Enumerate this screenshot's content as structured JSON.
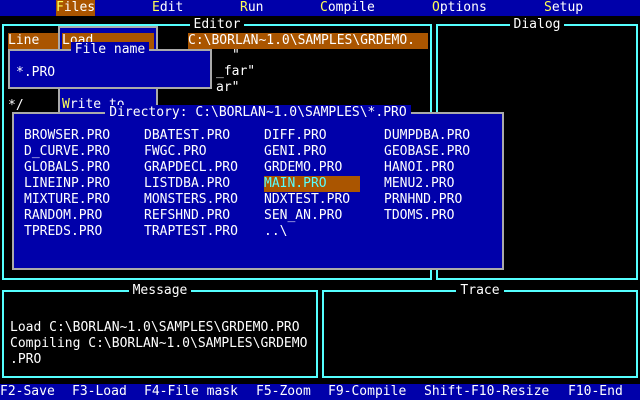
{
  "menu": {
    "items": [
      {
        "hot": "F",
        "rest": "iles",
        "active": true
      },
      {
        "hot": "E",
        "rest": "dit",
        "active": false
      },
      {
        "hot": "R",
        "rest": "un",
        "active": false
      },
      {
        "hot": "C",
        "rest": "ompile",
        "active": false
      },
      {
        "hot": "O",
        "rest": "ptions",
        "active": false
      },
      {
        "hot": "S",
        "rest": "etup",
        "active": false
      }
    ]
  },
  "editor": {
    "title": "Editor",
    "line_label": "Line",
    "path": "C:\\BORLAN~1.0\\SAMPLES\\GRDEMO.",
    "fragments": [
      "\"",
      "_far\"",
      "ar\""
    ],
    "comment_end": "*/"
  },
  "dialog_window": {
    "title": "Dialog"
  },
  "load_menu": {
    "load_label": "Load",
    "write_label": "Write to"
  },
  "file_name": {
    "title": "File name",
    "value": "*.PRO"
  },
  "directory": {
    "title": "Directory: C:\\BORLAN~1.0\\SAMPLES\\*.PRO",
    "columns": [
      [
        "BROWSER.PRO",
        "D_CURVE.PRO",
        "GLOBALS.PRO",
        "LINEINP.PRO",
        "MIXTURE.PRO",
        "RANDOM.PRO",
        "TPREDS.PRO"
      ],
      [
        "DBATEST.PRO",
        "FWGC.PRO",
        "GRAPDECL.PRO",
        "LISTDBA.PRO",
        "MONSTERS.PRO",
        "REFSHND.PRO",
        "TRAPTEST.PRO"
      ],
      [
        "DIFF.PRO",
        "GENI.PRO",
        "GRDEMO.PRO",
        "MAIN.PRO",
        "NDXTEST.PRO",
        "SEN_AN.PRO",
        "..\\"
      ],
      [
        "DUMPDBA.PRO",
        "GEOBASE.PRO",
        "HANOI.PRO",
        "MENU2.PRO",
        "PRNHND.PRO",
        "TDOMS.PRO"
      ]
    ],
    "selected": "MAIN.PRO"
  },
  "message": {
    "title": "Message",
    "lines": [
      "Load C:\\BORLAN~1.0\\SAMPLES\\GRDEMO.PRO",
      "Compiling C:\\BORLAN~1.0\\SAMPLES\\GRDEMO",
      ".PRO"
    ]
  },
  "trace": {
    "title": "Trace"
  },
  "status": {
    "keys": [
      "F2-Save",
      "F3-Load",
      "F4-File mask",
      "F5-Zoom",
      "F9-Compile",
      "Shift-F10-Resize",
      "F10-End"
    ]
  },
  "colors": {
    "background": "#000000",
    "menubar": "#0000aa",
    "hotkey": "#ffff55",
    "active_menu": "#aa5500",
    "editor_border": "#55ffff",
    "dialog_border": "#aaaaaa",
    "selection": "#aa5500"
  }
}
